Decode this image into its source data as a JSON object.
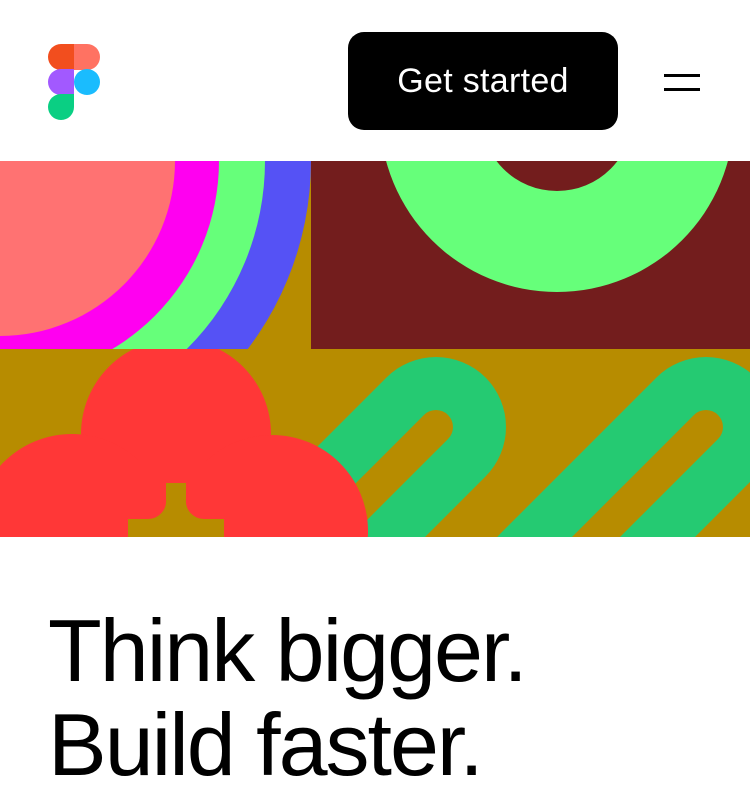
{
  "header": {
    "logo_icon": "figma-logo-icon",
    "cta_label": "Get started",
    "menu_icon": "hamburger-menu-icon"
  },
  "hero": {
    "artwork": "abstract-shapes-illustration",
    "colors": {
      "mustard": "#B78C00",
      "maroon": "#731D1D",
      "neon_green": "#66FF7A",
      "blue": "#5552F5",
      "magenta": "#FF00F0",
      "salmon": "#FF7272",
      "red": "#FF3737",
      "green": "#25CA72"
    }
  },
  "headline": {
    "line1": "Think bigger.",
    "line2": "Build faster."
  },
  "logo_colors": [
    "#F24E1E",
    "#FF7262",
    "#A259FF",
    "#1ABCFE",
    "#0ACF83"
  ]
}
